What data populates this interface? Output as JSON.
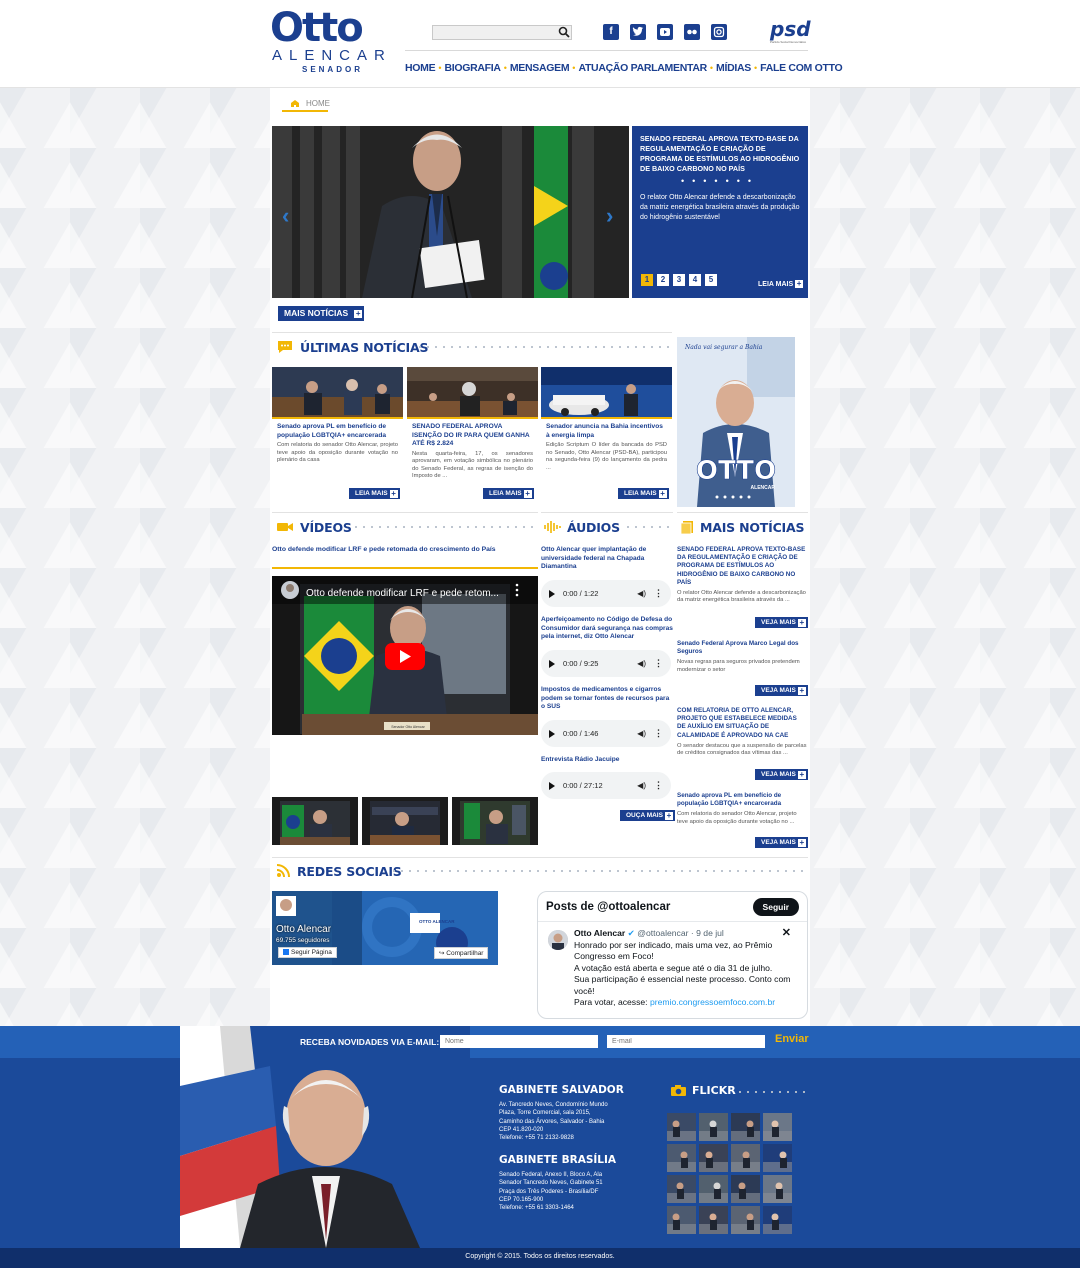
{
  "header": {
    "logo": {
      "name": "Otto",
      "surname": "ALENCAR",
      "role": "SENADOR"
    },
    "search": {
      "placeholder": ""
    },
    "social_icons": [
      "facebook-icon",
      "twitter-icon",
      "youtube-icon",
      "flickr-icon",
      "instagram-icon"
    ],
    "party_logo": {
      "text": "psd",
      "tagline": "Partido Social Democrático"
    },
    "nav": [
      "HOME",
      "BIOGRAFIA",
      "MENSAGEM",
      "ATUAÇÃO PARLAMENTAR",
      "MÍDIAS",
      "FALE COM OTTO"
    ]
  },
  "breadcrumb": "HOME",
  "slider": {
    "headline": "SENADO FEDERAL APROVA TEXTO-BASE DA REGULAMENTAÇÃO E CRIAÇÃO DE PROGRAMA DE ESTÍMULOS AO HIDROGÊNIO DE BAIXO CARBONO NO PAÍS",
    "summary": "O relator Otto Alencar defende a descarbonização da matriz energética brasileira através da produção do hidrogênio sustentável",
    "pages": [
      "1",
      "2",
      "3",
      "4",
      "5"
    ],
    "active_page": "1",
    "read_more": "LEIA MAIS"
  },
  "mais_noticias_button": "MAIS NOTÍCIAS",
  "ultimas_noticias": {
    "title": "ÚLTIMAS NOTÍCIAS",
    "items": [
      {
        "title": "Senado aprova PL em benefício de população LGBTQIA+ encarcerada",
        "text": "Com relatoria do senador Otto Alencar, projeto teve apoio da oposição durante votação no plenário da casa",
        "button": "LEIA MAIS"
      },
      {
        "title": "SENADO FEDERAL APROVA ISENÇÃO DO IR PARA QUEM GANHA ATÉ R$ 2.824",
        "text": "Nesta quarta-feira, 17, os senadores aprovaram, em votação simbólica no plenário do Senado Federal, as regras de isenção do Imposto de ...",
        "button": "LEIA MAIS"
      },
      {
        "title": "Senador anuncia na Bahia incentivos à energia limpa",
        "text": "Edição Scriptum O líder da bancada do PSD no Senado, Otto Alencar (PSD-BA), participou na segunda-feira (9) do lançamento da pedra ...",
        "button": "LEIA MAIS"
      }
    ]
  },
  "banner": {
    "script": "Nada vai segurar a Bahia",
    "name": "OTTO",
    "surname": "ALENCAR"
  },
  "videos": {
    "title": "VÍDEOS",
    "caption": "Otto defende modificar LRF e pede retomada do crescimento do País",
    "player_title": "Otto defende modificar LRF e pede retom...",
    "name_plate": "Senador Otto Alencar"
  },
  "audios": {
    "title": "ÁUDIOS",
    "items": [
      {
        "title": "Otto Alencar quer implantação de universidade federal na Chapada Diamantina",
        "time": "0:00 / 1:22"
      },
      {
        "title": "Aperfeiçoamento no Código de Defesa do Consumidor dará segurança nas compras pela internet, diz Otto Alencar",
        "time": "0:00 / 9:25"
      },
      {
        "title": "Impostos de medicamentos e cigarros podem se tornar fontes de recursos para o SUS",
        "time": "0:00 / 1:46"
      },
      {
        "title": "Entrevista Rádio Jacuipe",
        "time": "0:00 / 27:12"
      }
    ],
    "button": "OUÇA MAIS"
  },
  "mais_noticias": {
    "title": "MAIS NOTÍCIAS",
    "items": [
      {
        "title": "SENADO FEDERAL APROVA TEXTO-BASE DA REGULAMENTAÇÃO E CRIAÇÃO DE PROGRAMA DE ESTÍMULOS AO HIDROGÊNIO DE BAIXO CARBONO NO PAÍS",
        "text": "O relator Otto Alencar defende a descarbonização da matriz energética brasileira através da ...",
        "button": "VEJA MAIS"
      },
      {
        "title": "Senado Federal Aprova Marco Legal dos Seguros",
        "text": "Novas regras para seguros privados pretendem modernizar o setor",
        "button": "VEJA MAIS"
      },
      {
        "title": "COM RELATORIA DE OTTO ALENCAR, PROJETO QUE ESTABELECE MEDIDAS DE AUXÍLIO EM SITUAÇÃO DE CALAMIDADE É APROVADO NA CAE",
        "text": "O senador destacou que a suspensão de parcelas de créditos consignados das vítimas das ...",
        "button": "VEJA MAIS"
      },
      {
        "title": "Senado aprova PL em benefício de população LGBTQIA+ encarcerada",
        "text": "Com relatoria do senador Otto Alencar, projeto teve apoio da oposição durante votação no ...",
        "button": "VEJA MAIS"
      }
    ]
  },
  "redes_sociais": {
    "title": "REDES SOCIAIS",
    "facebook": {
      "page_name": "Otto Alencar",
      "followers": "69.755 seguidores",
      "follow_button": "Seguir Página",
      "share_button": "Compartilhar",
      "badge": "OTTO ALENCAR"
    },
    "twitter": {
      "header": "Posts de @ottoalencar",
      "follow_button": "Seguir",
      "author": "Otto Alencar",
      "handle": "@ottoalencar · 9 de jul",
      "lines": [
        "Honrado por ser indicado, mais uma vez, ao Prêmio Congresso em Foco!",
        "A votação está aberta e segue até o dia 31 de julho.",
        "Sua participação é essencial neste processo. Conto com você!"
      ],
      "link_prefix": "Para votar, acesse: ",
      "link": "premio.congressoemfoco.com.br"
    }
  },
  "footer": {
    "newsletter": {
      "label": "RECEBA NOVIDADES VIA E-MAIL:",
      "name_placeholder": "Nome",
      "email_placeholder": "E-mail",
      "send": "Enviar"
    },
    "gabinete_salvador": {
      "title": "GABINETE SALVADOR",
      "lines": [
        "Av. Tancredo Neves, Condomínio Mundo",
        "Plaza, Torre Comercial, sala 2015,",
        "Caminho das Árvores, Salvador - Bahia",
        "CEP 41.820-020",
        "Telefone: +55 71 2132-9828"
      ]
    },
    "gabinete_brasilia": {
      "title": "GABINETE BRASÍLIA",
      "lines": [
        "Senado Federal, Anexo II, Bloco A, Ala",
        "Senador Tancredo Neves, Gabinete 51",
        "Praça dos Três Poderes - Brasília/DF",
        "CEP 70.165-900",
        "Telefone: +55 61 3303-1464"
      ]
    },
    "flickr_title": "FLICKR",
    "copyright": "Copyright © 2015. Todos os direitos reservados."
  },
  "colors": {
    "primary": "#1b3f8f",
    "accent": "#f2b705",
    "footer": "#1b4a9a",
    "newsletter": "#2461b7"
  }
}
